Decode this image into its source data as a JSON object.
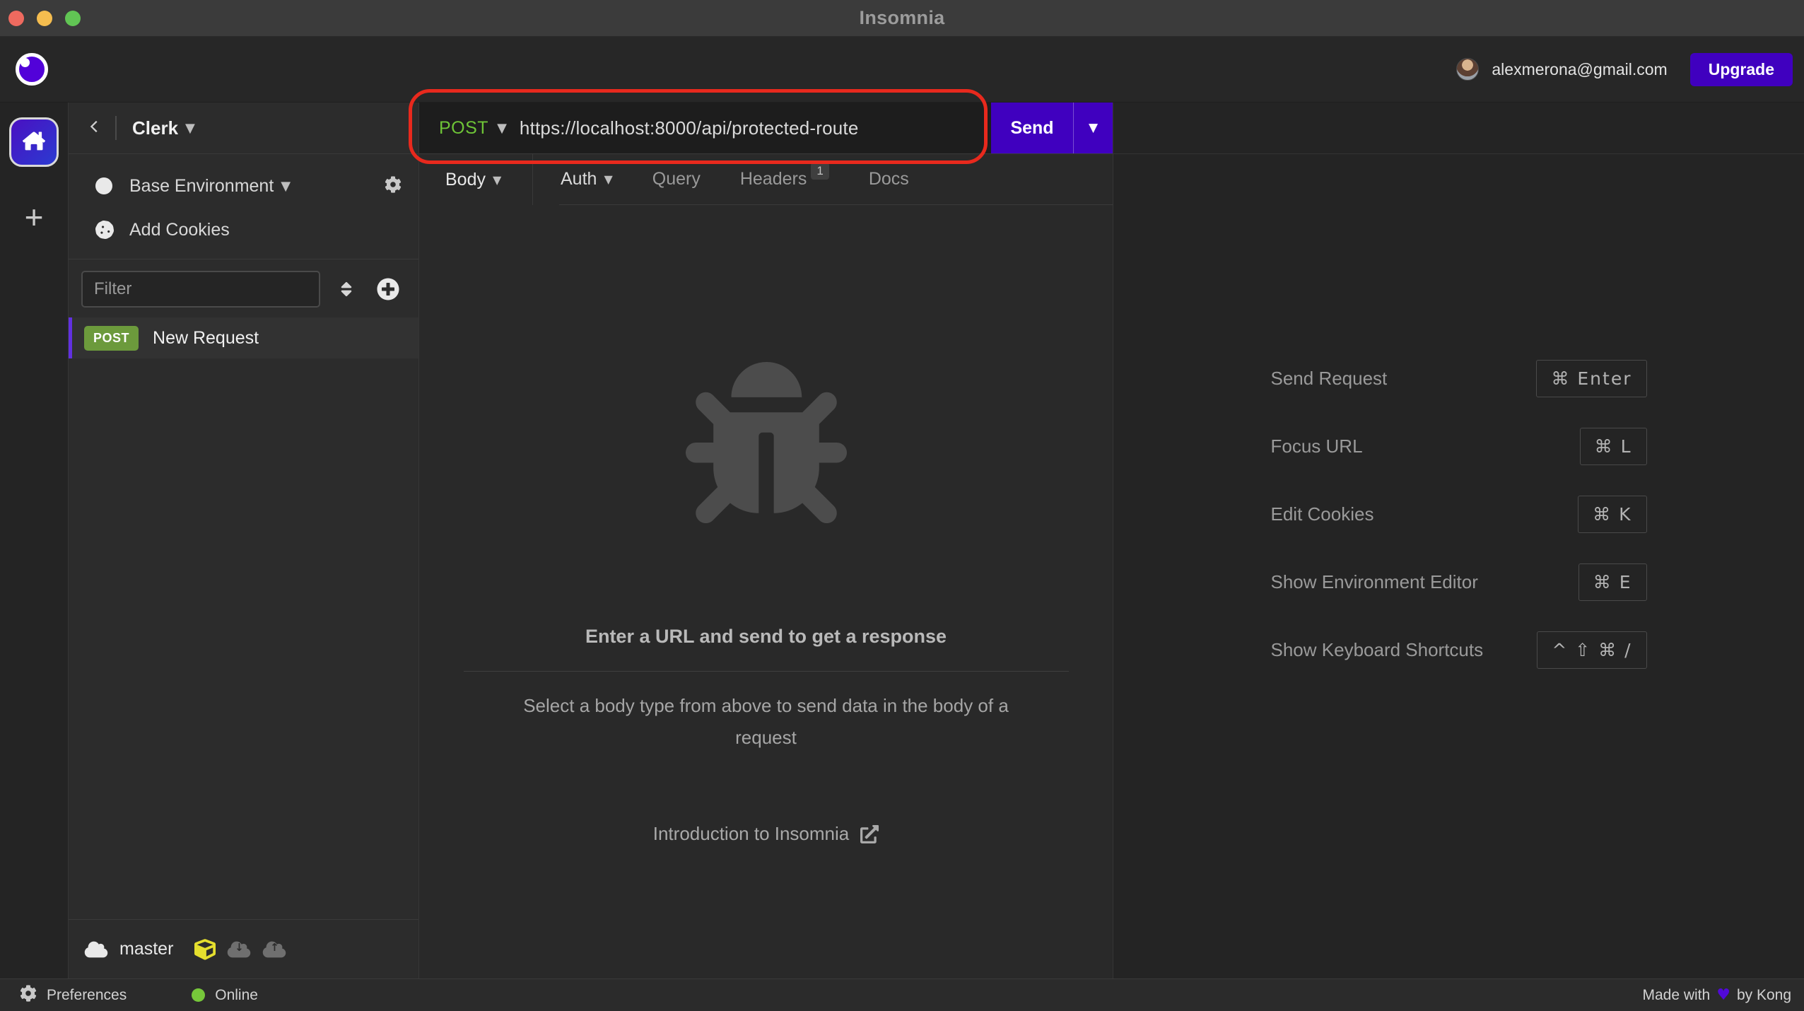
{
  "window": {
    "title": "Insomnia"
  },
  "header": {
    "email": "alexmerona@gmail.com",
    "upgrade_label": "Upgrade"
  },
  "sidebar": {
    "workspace": "Clerk",
    "environment_label": "Base Environment",
    "add_cookies_label": "Add Cookies",
    "filter_placeholder": "Filter",
    "requests": [
      {
        "method": "POST",
        "name": "New Request"
      }
    ],
    "branch": "master"
  },
  "request": {
    "method": "POST",
    "url": "https://localhost:8000/api/protected-route",
    "send_label": "Send",
    "tabs": [
      {
        "label": "Body"
      },
      {
        "label": "Auth"
      },
      {
        "label": "Query"
      },
      {
        "label": "Headers",
        "badge": "1"
      },
      {
        "label": "Docs"
      }
    ]
  },
  "empty_state": {
    "title": "Enter a URL and send to get a response",
    "body": "Select a body type from above to send data in the body of a request",
    "link_label": "Introduction to Insomnia"
  },
  "shortcuts": [
    {
      "label": "Send Request",
      "keys": "⌘ Enter"
    },
    {
      "label": "Focus URL",
      "keys": "⌘ L"
    },
    {
      "label": "Edit Cookies",
      "keys": "⌘ K"
    },
    {
      "label": "Show Environment Editor",
      "keys": "⌘ E"
    },
    {
      "label": "Show Keyboard Shortcuts",
      "keys": "^ ⇧ ⌘ /"
    }
  ],
  "statusbar": {
    "preferences_label": "Preferences",
    "online_label": "Online",
    "made_with": "Made with",
    "by": "by Kong",
    "heart": "♥"
  },
  "colors": {
    "accent_purple": "#4000bf",
    "method_post_green": "#6ec437",
    "post_badge_green": "#6c9a3c",
    "annotation_red": "#e8291d",
    "online_green": "#76c73a",
    "sync_cube_yellow": "#e5df2e"
  }
}
